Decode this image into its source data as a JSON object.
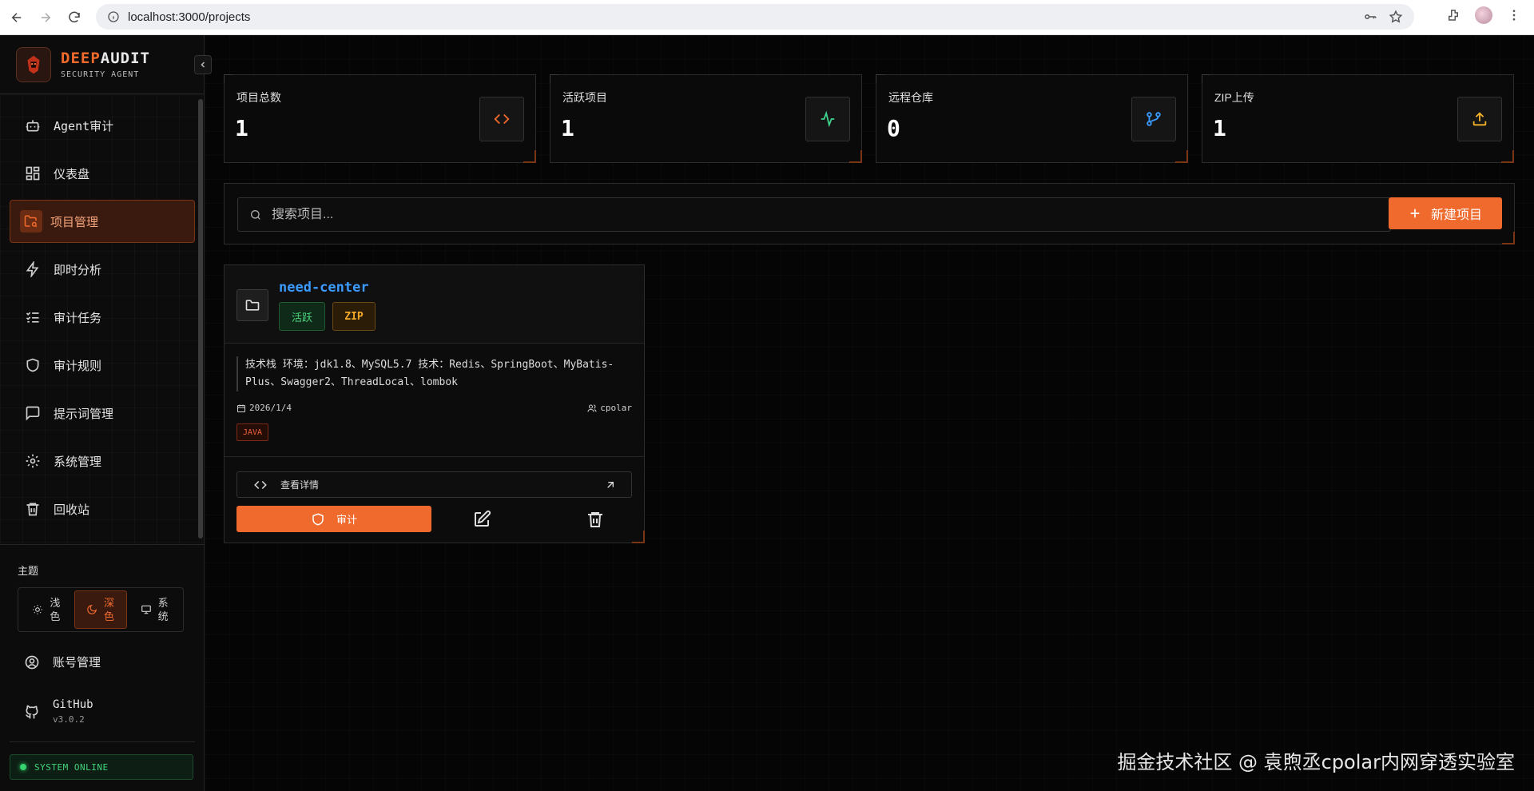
{
  "browser": {
    "url": "localhost:3000/projects"
  },
  "brand": {
    "name_highlight": "DEEP",
    "name_rest": "AUDIT",
    "subtitle": "SECURITY AGENT"
  },
  "sidebar": {
    "items": [
      {
        "label": "Agent审计",
        "icon": "bot-icon"
      },
      {
        "label": "仪表盘",
        "icon": "dashboard-icon"
      },
      {
        "label": "项目管理",
        "icon": "folder-search-icon",
        "active": true
      },
      {
        "label": "即时分析",
        "icon": "zap-icon"
      },
      {
        "label": "审计任务",
        "icon": "list-checks-icon"
      },
      {
        "label": "审计规则",
        "icon": "shield-icon"
      },
      {
        "label": "提示词管理",
        "icon": "message-square-icon"
      },
      {
        "label": "系统管理",
        "icon": "gear-icon"
      },
      {
        "label": "回收站",
        "icon": "trash-icon"
      }
    ],
    "theme": {
      "title": "主题",
      "options": [
        {
          "label": "浅色",
          "icon": "sun-icon"
        },
        {
          "label": "深色",
          "icon": "moon-icon",
          "active": true
        },
        {
          "label": "系统",
          "icon": "monitor-icon"
        }
      ]
    },
    "account": {
      "label": "账号管理"
    },
    "github": {
      "label": "GitHub",
      "version": "v3.0.2"
    },
    "status": "SYSTEM ONLINE"
  },
  "stats": [
    {
      "label": "项目总数",
      "value": "1",
      "icon": "code-icon",
      "color": "#f26b2d"
    },
    {
      "label": "活跃项目",
      "value": "1",
      "icon": "activity-icon",
      "color": "#3fd18c"
    },
    {
      "label": "远程仓库",
      "value": "0",
      "icon": "git-branch-icon",
      "color": "#3b9bff"
    },
    {
      "label": "ZIP上传",
      "value": "1",
      "icon": "upload-icon",
      "color": "#f3b22a"
    }
  ],
  "search": {
    "placeholder": "搜索项目...",
    "new_button": "新建项目"
  },
  "project": {
    "name": "need-center",
    "status_badge": "活跃",
    "source_badge": "ZIP",
    "description_line1": "技术栈 环境：jdk1.8、MySQL5.7 技术：Redis、SpringBoot、MyBatis-",
    "description_line2": "Plus、Swagger2、ThreadLocal、lombok",
    "date": "2026/1/4",
    "owner": "cpolar",
    "language_tag": "JAVA",
    "detail_button": "查看详情",
    "audit_button": "审计"
  },
  "watermark": "掘金技术社区 @ 袁煦丞cpolar内网穿透实验室"
}
